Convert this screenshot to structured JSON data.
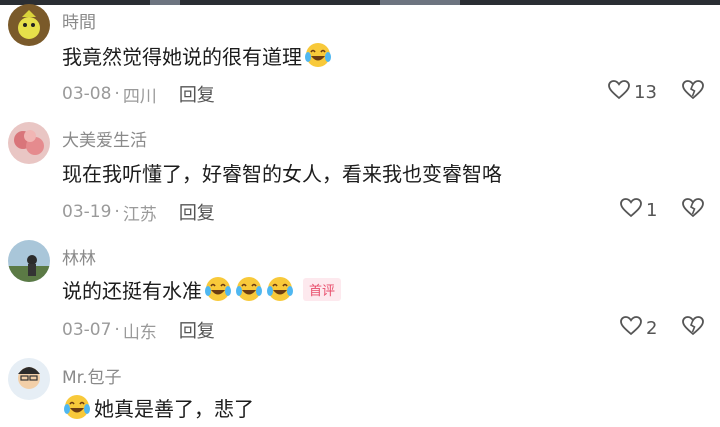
{
  "comments": [
    {
      "username": "時間",
      "text": "我竟然觉得她说的很有道理",
      "emoji": "laughing-crying-emoji",
      "date": "03-08",
      "location": "四川",
      "reply_label": "回复",
      "likes": "13"
    },
    {
      "username": "大美爱生活",
      "text": "现在我听懂了，好睿智的女人，看来我也变睿智咯",
      "date": "03-19",
      "location": "江苏",
      "reply_label": "回复",
      "likes": "1"
    },
    {
      "username": "林林",
      "text": "说的还挺有水准",
      "emoji_count": 3,
      "badge": "首评",
      "date": "03-07",
      "location": "山东",
      "reply_label": "回复",
      "likes": "2"
    },
    {
      "username": "Mr.包子",
      "text": "她真是善了，悲了"
    }
  ],
  "separator": "·",
  "colors": {
    "username": "#8a8a8a",
    "text": "#1c1c1c",
    "meta": "#9a9a9a",
    "badge": "#e84d6b",
    "badge_bg": "#fde9ee"
  }
}
